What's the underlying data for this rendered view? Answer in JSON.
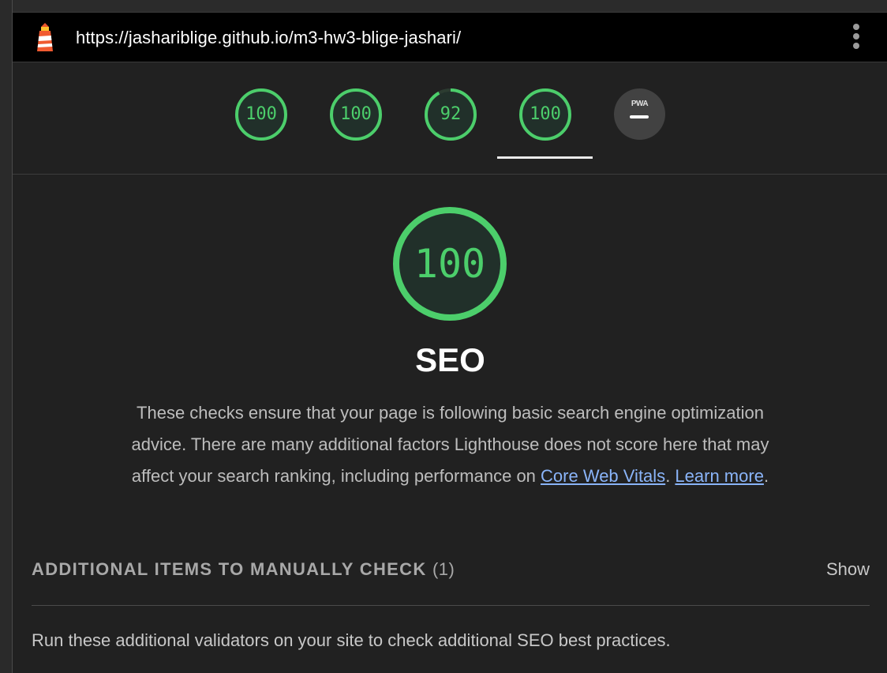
{
  "header": {
    "url": "https://jashariblige.github.io/m3-hw3-blige-jashari/",
    "logo_icon": "lighthouse-icon",
    "menu_icon": "more-vert-icon"
  },
  "gauges": [
    {
      "name": "performance",
      "score": "100",
      "value": 1.0
    },
    {
      "name": "accessibility",
      "score": "100",
      "value": 1.0
    },
    {
      "name": "best-practices",
      "score": "92",
      "value": 0.92
    },
    {
      "name": "seo",
      "score": "100",
      "value": 1.0,
      "active": true
    }
  ],
  "pwa": {
    "label": "PWA",
    "icon": "dash-icon"
  },
  "category": {
    "score": "100",
    "value": 1.0,
    "title": "SEO",
    "description_prefix": "These checks ensure that your page is following basic search engine optimization advice. There are many additional factors Lighthouse does not score here that may affect your search ranking, including performance on ",
    "link_vitals": "Core Web Vitals",
    "sep": ". ",
    "link_learn": "Learn more",
    "end": "."
  },
  "manual_section": {
    "title": "ADDITIONAL ITEMS TO MANUALLY CHECK",
    "count": "(1)",
    "show_label": "Show",
    "description": "Run these additional validators on your site to check additional SEO best practices."
  },
  "colors": {
    "pass": "#4cce6b",
    "link": "#8ab4f8",
    "background": "#212121"
  }
}
